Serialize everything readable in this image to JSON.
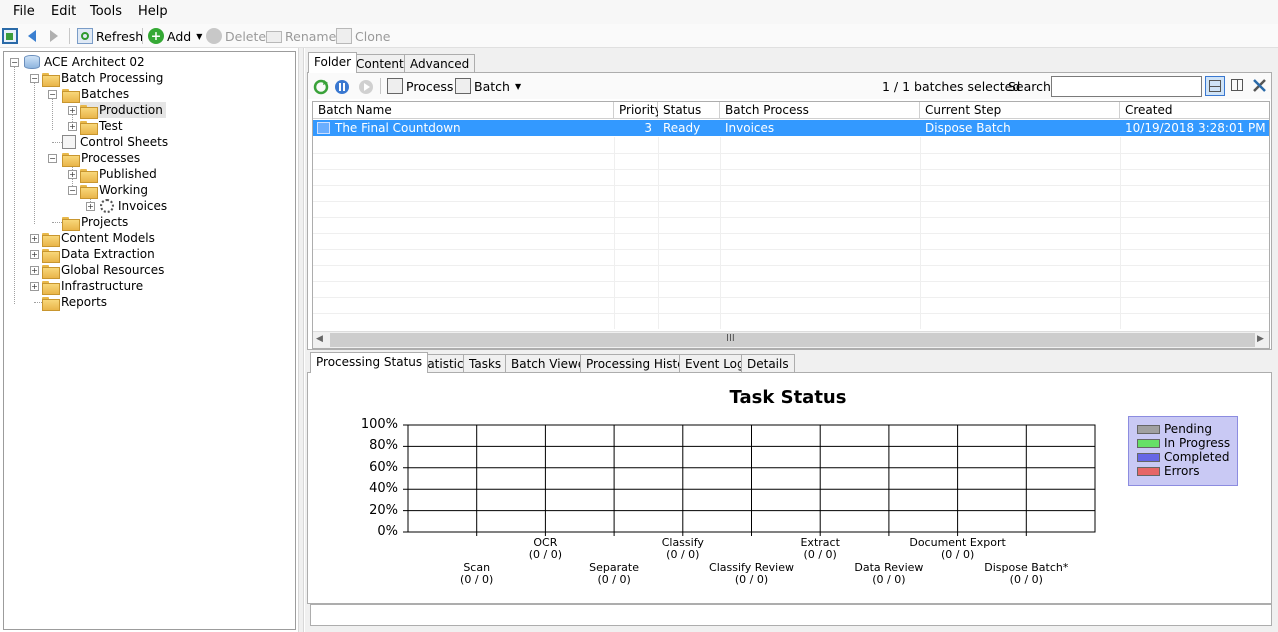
{
  "menu": {
    "file": "File",
    "edit": "Edit",
    "tools": "Tools",
    "help": "Help"
  },
  "toolbar": {
    "refresh": "Refresh",
    "add": "Add",
    "delete": "Delete",
    "rename": "Rename",
    "clone": "Clone"
  },
  "tree": {
    "root": "ACE Architect 02",
    "batch_processing": "Batch Processing",
    "batches": "Batches",
    "production": "Production",
    "test": "Test",
    "control_sheets": "Control Sheets",
    "processes": "Processes",
    "published": "Published",
    "working": "Working",
    "invoices": "Invoices",
    "projects": "Projects",
    "content_models": "Content Models",
    "data_extraction": "Data Extraction",
    "global_resources": "Global Resources",
    "infrastructure": "Infrastructure",
    "reports": "Reports"
  },
  "top_tabs": [
    "Folder",
    "Contents",
    "Advanced"
  ],
  "folder_toolbar": {
    "process": "Process",
    "batch": "Batch",
    "selected": "1 / 1 batches selected",
    "search_label": "Search:",
    "search_value": ""
  },
  "grid": {
    "headers": [
      "Batch Name",
      "Priority",
      "Status",
      "Batch Process",
      "Current Step",
      "Created"
    ],
    "rows": [
      {
        "name": "The Final Countdown",
        "priority": "3",
        "status": "Ready",
        "process": "Invoices",
        "step": "Dispose Batch",
        "created": "10/19/2018 3:28:01 PM"
      }
    ],
    "scroll_thumb": "III"
  },
  "bottom_tabs": [
    "Processing Status",
    "Statistics",
    "Tasks",
    "Batch Viewer",
    "Processing History",
    "Event Log",
    "Details"
  ],
  "chart_data": {
    "type": "bar",
    "title": "Task Status",
    "ylim": [
      0,
      100
    ],
    "yticks": [
      "100%",
      "80%",
      "60%",
      "40%",
      "20%",
      "0%"
    ],
    "categories": [
      "Scan",
      "OCR",
      "Separate",
      "Classify",
      "Classify Review",
      "Extract",
      "Data Review",
      "Document Export",
      "Dispose Batch*"
    ],
    "category_values": [
      "(0 / 0)",
      "(0 / 0)",
      "(0 / 0)",
      "(0 / 0)",
      "(0 / 0)",
      "(0 / 0)",
      "(0 / 0)",
      "(0 / 0)",
      "(0 / 0)"
    ],
    "series": [
      {
        "name": "Pending",
        "color": "#a0a0a0",
        "values": [
          0,
          0,
          0,
          0,
          0,
          0,
          0,
          0,
          0
        ]
      },
      {
        "name": "In Progress",
        "color": "#66e066",
        "values": [
          0,
          0,
          0,
          0,
          0,
          0,
          0,
          0,
          0
        ]
      },
      {
        "name": "Completed",
        "color": "#6666e6",
        "values": [
          0,
          0,
          0,
          0,
          0,
          0,
          0,
          0,
          0
        ]
      },
      {
        "name": "Errors",
        "color": "#e66666",
        "values": [
          0,
          0,
          0,
          0,
          0,
          0,
          0,
          0,
          0
        ]
      }
    ],
    "grid": true,
    "legend": "right"
  },
  "colors": {
    "selection": "#3399ff",
    "legend_bg": "#c9c9f4"
  }
}
